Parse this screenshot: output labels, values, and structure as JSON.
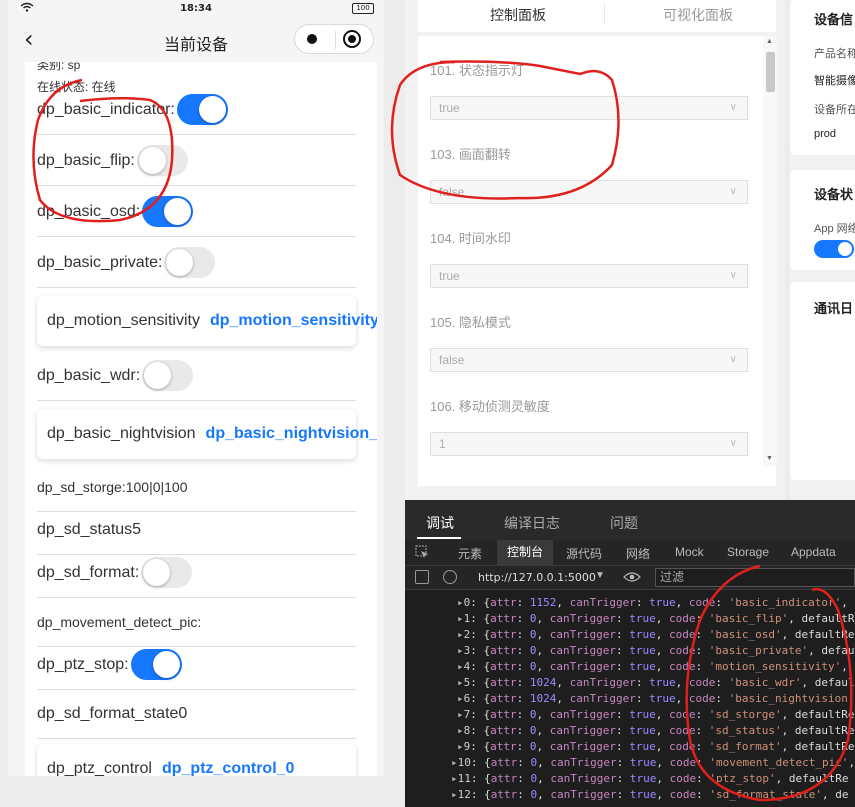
{
  "phone": {
    "status_time": "18:34",
    "battery": "100",
    "nav_title": "当前设备",
    "info_category": "类别: sp",
    "info_online": "在线状态: 在线",
    "rows": [
      {
        "label": "dp_basic_indicator:",
        "toggle": true
      },
      {
        "label": "dp_basic_flip:",
        "toggle": false
      },
      {
        "label": "dp_basic_osd:",
        "toggle": true
      },
      {
        "label": "dp_basic_private:",
        "toggle": false
      }
    ],
    "motion_label": "dp_motion_sensitivity",
    "motion_value": "dp_motion_sensitivity",
    "wdr_label": "dp_basic_wdr:",
    "wdr_toggle": false,
    "night_label": "dp_basic_nightvision",
    "night_value": "dp_basic_nightvision_",
    "sd_storge": "dp_sd_storge:100|0|100",
    "sd_status": "dp_sd_status5",
    "sd_format_label": "dp_sd_format:",
    "sd_format_toggle": false,
    "movement_pic": "dp_movement_detect_pic:",
    "ptz_stop_label": "dp_ptz_stop:",
    "ptz_stop_toggle": true,
    "sd_format_state": "dp_sd_format_state0",
    "ptz_control_label": "dp_ptz_control",
    "ptz_control_value": "dp_ptz_control_0"
  },
  "mid": {
    "tab_active": "控制面板",
    "tab_inactive": "可视化面板",
    "fields": [
      {
        "label": "101. 状态指示灯",
        "value": "true"
      },
      {
        "label": "103. 画面翻转",
        "value": "false"
      },
      {
        "label": "104. 时间水印",
        "value": "true"
      },
      {
        "label": "105. 隐私模式",
        "value": "false"
      },
      {
        "label": "106. 移动侦测灵敏度",
        "value": "1"
      }
    ]
  },
  "right": {
    "card1_title": "设备信",
    "card1_l1": "产品名称",
    "card1_l2": "智能摄像",
    "card1_l3": "设备所在",
    "card1_l4": "prod",
    "card2_title": "设备状",
    "card2_l1": "App 网络",
    "card3_title": "通讯日"
  },
  "devtools": {
    "tabs": [
      "调试",
      "编译日志",
      "问题"
    ],
    "sub_tabs": [
      "元素",
      "控制台",
      "源代码",
      "网络",
      "Mock",
      "Storage",
      "Appdata"
    ],
    "url": "http://127.0.0.1:5000",
    "filter_placeholder": "过滤",
    "lines": [
      {
        "idx": "0",
        "attr": "1152",
        "code": "'basic_indicator'",
        "tail": ","
      },
      {
        "idx": "1",
        "attr": "0",
        "code": "'basic_flip'",
        "tail": ", defaultRe"
      },
      {
        "idx": "2",
        "attr": "0",
        "code": "'basic_osd'",
        "tail": ", defaultRe"
      },
      {
        "idx": "3",
        "attr": "0",
        "code": "'basic_private'",
        "tail": ", defau"
      },
      {
        "idx": "4",
        "attr": "0",
        "code": "'motion_sensitivity'",
        "tail": ","
      },
      {
        "idx": "5",
        "attr": "1024",
        "code": "'basic_wdr'",
        "tail": ", defaul"
      },
      {
        "idx": "6",
        "attr": "1024",
        "code": "'basic_nightvision'",
        "tail": ""
      },
      {
        "idx": "7",
        "attr": "0",
        "code": "'sd_storge'",
        "tail": ", defaultRe"
      },
      {
        "idx": "8",
        "attr": "0",
        "code": "'sd_status'",
        "tail": ", defaultRe"
      },
      {
        "idx": "9",
        "attr": "0",
        "code": "'sd_format'",
        "tail": ", defaultRe"
      },
      {
        "idx": "10",
        "attr": "0",
        "code": "'movement_detect_pic'",
        "tail": ","
      },
      {
        "idx": "11",
        "attr": "0",
        "code": "'ptz_stop'",
        "tail": ", defaultRe"
      },
      {
        "idx": "12",
        "attr": "0",
        "code": "'sd_format_state'",
        "tail": ", de"
      }
    ]
  },
  "colors": {
    "accent": "#1677ff",
    "annotation": "#e0201c"
  }
}
